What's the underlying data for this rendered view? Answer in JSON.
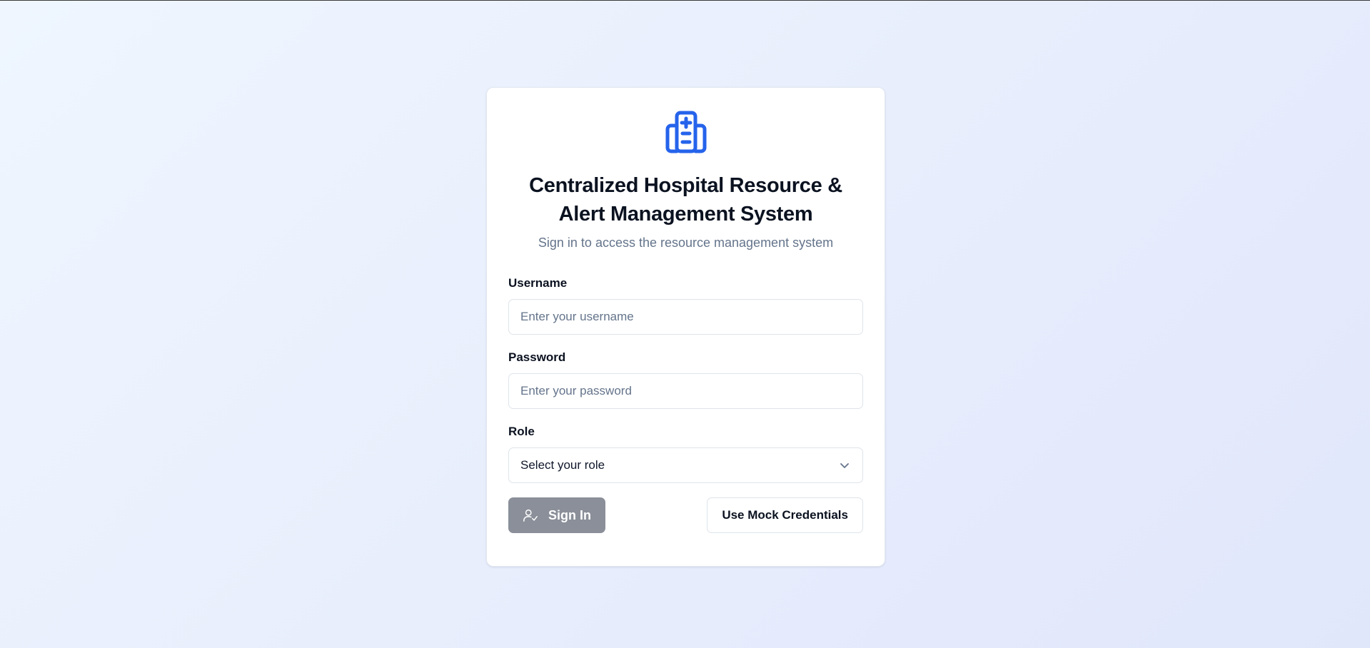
{
  "header": {
    "logo_icon": "hospital-icon",
    "title": "Centralized Hospital Resource & Alert Management System",
    "subtitle": "Sign in to access the resource management system"
  },
  "form": {
    "username": {
      "label": "Username",
      "placeholder": "Enter your username",
      "value": ""
    },
    "password": {
      "label": "Password",
      "placeholder": "Enter your password",
      "value": ""
    },
    "role": {
      "label": "Role",
      "selected": "Select your role",
      "icon": "chevron-down-icon"
    }
  },
  "actions": {
    "sign_in_label": "Sign In",
    "sign_in_icon": "user-check-icon",
    "mock_label": "Use Mock Credentials"
  },
  "colors": {
    "brand": "#2563eb",
    "sign_in_disabled_bg": "#8a8f99",
    "text_primary": "#0b1220",
    "text_muted": "#64748b"
  }
}
